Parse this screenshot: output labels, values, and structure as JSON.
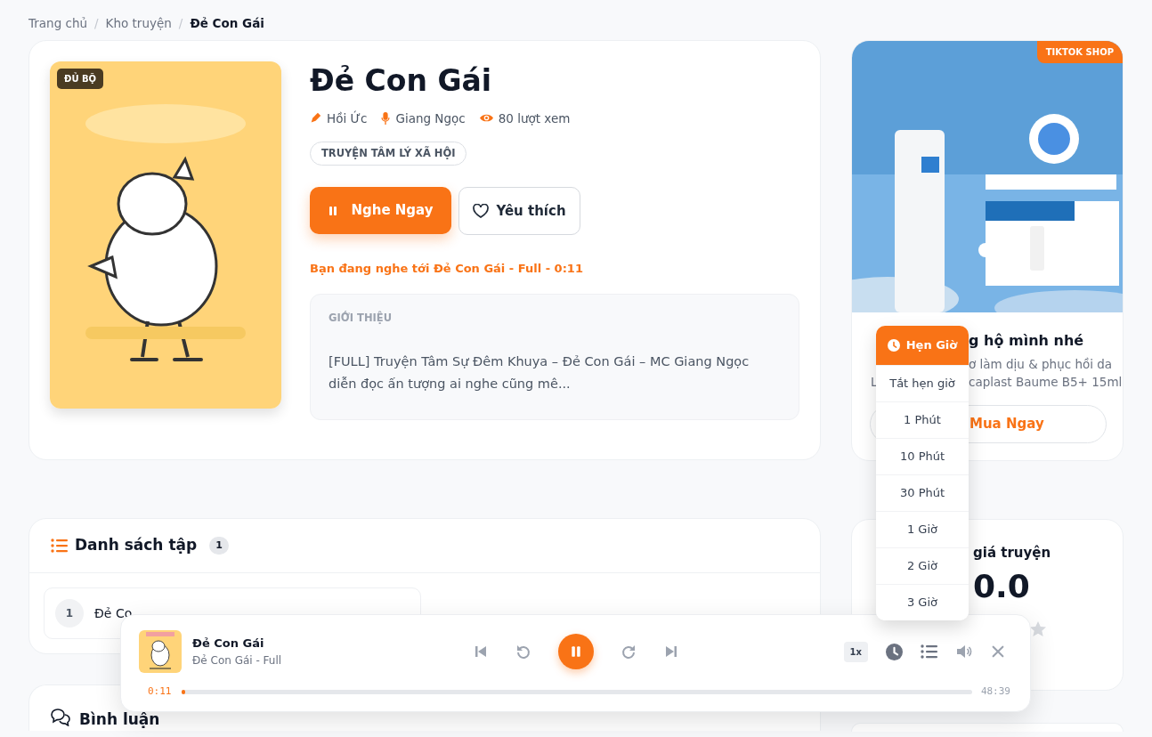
{
  "breadcrumb_separator": "/",
  "breadcrumb": [
    {
      "label": "Trang chủ",
      "current": false
    },
    {
      "label": "Kho truyện",
      "current": false
    },
    {
      "label": "Đẻ Con Gái",
      "current": true
    }
  ],
  "story": {
    "badge": "ĐỦ BỘ",
    "title": "Đẻ Con Gái",
    "meta": [
      {
        "kind": "author",
        "text": "Hồi Ức"
      },
      {
        "kind": "narrator",
        "text": "Giang Ngọc"
      },
      {
        "kind": "views",
        "text": "80 lượt xem"
      }
    ],
    "tags": [
      "TRUYỆN TÂM LÝ XÃ HỘI"
    ],
    "listen_button": "Nghe Ngay",
    "favorite_button": "Yêu thích",
    "progress_note": "Bạn đang nghe tới Đẻ Con Gái - Full - 0:11",
    "intro": {
      "heading": "GIỚI THIỆU",
      "text": "[FULL] Truyện Tâm Sự Đêm Khuya – Đẻ Con Gái – MC Giang Ngọc diễn đọc ấn tượng ai nghe cũng mê..."
    }
  },
  "ad": {
    "badge": "TIKTOK SHOP",
    "title": "g hộ mình nhé",
    "desc_line_1": "ơ làm dịu & phục hồi da",
    "desc_line_2_start": "L",
    "desc_line_2": "caplast Baume B5+ 15ml",
    "button": "Mua Ngay"
  },
  "episodes": {
    "title": "Danh sách tập",
    "count": "1",
    "items": [
      {
        "number": "1",
        "title": "Đẻ Co"
      }
    ]
  },
  "rating": {
    "title": "giá truyện",
    "score": "0.0"
  },
  "comments": {
    "title": "Bình luận"
  },
  "player": {
    "title": "Đẻ Con Gái",
    "subtitle": "Đẻ Con Gái - Full",
    "playing": true,
    "speed": "1x",
    "elapsed": "0:11",
    "duration": "48:39",
    "level": 0.004
  },
  "timer_menu": {
    "title": "Hẹn Giờ",
    "options": [
      {
        "label": "Tắt hẹn giờ",
        "selected": false
      },
      {
        "label": "1 Phút",
        "selected": false
      },
      {
        "label": "10 Phút",
        "selected": false
      },
      {
        "label": "30 Phút",
        "selected": false
      },
      {
        "label": "1 Giờ",
        "selected": false
      },
      {
        "label": "2 Giờ",
        "selected": false
      },
      {
        "label": "3 Giờ",
        "selected": false
      }
    ]
  }
}
